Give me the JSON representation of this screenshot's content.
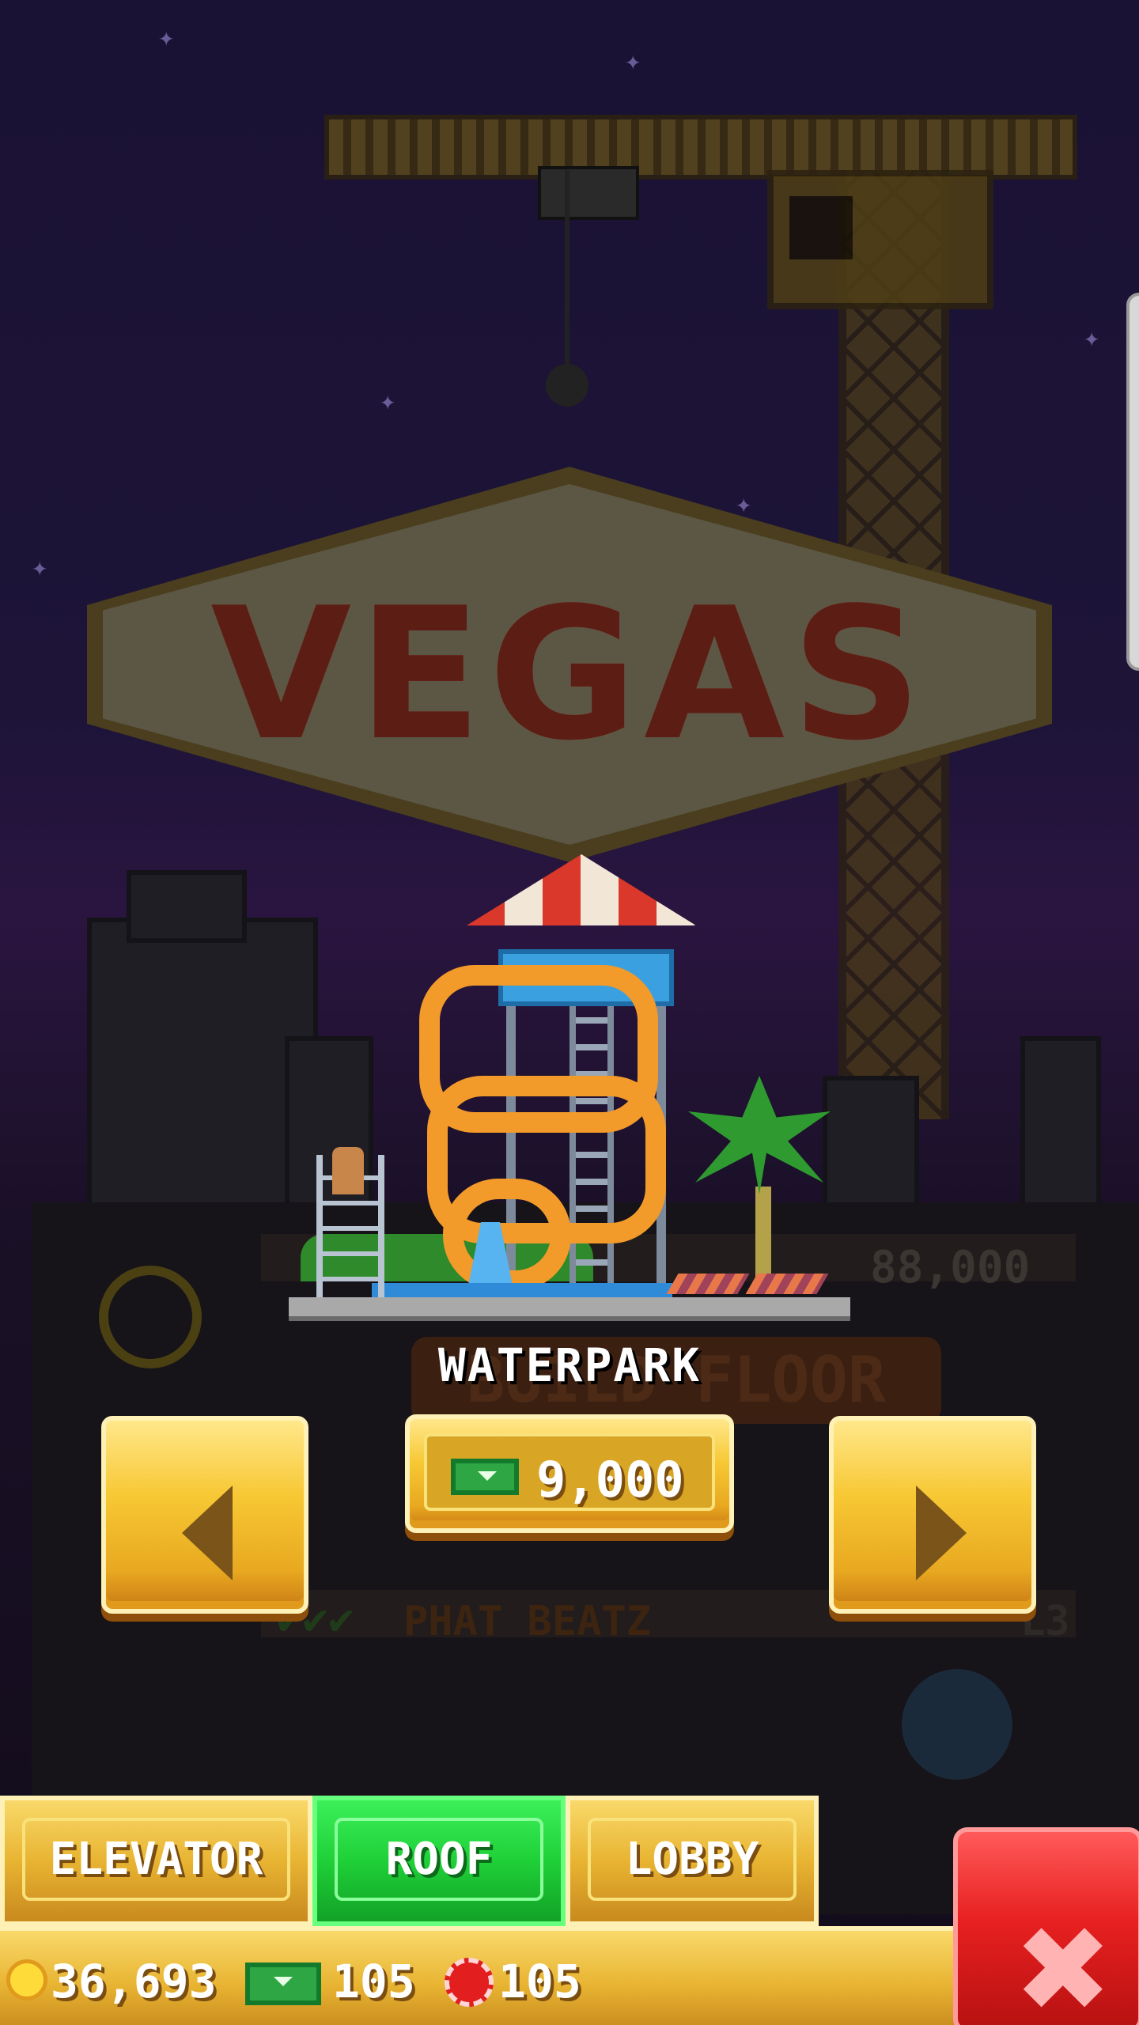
{
  "background": {
    "sign_text": "VEGAS",
    "dim_price": "88,000",
    "dim_build_floor": "BUILD FLOOR",
    "dim_floor_name": "PHAT BEATZ",
    "dim_floor_level": "L3",
    "dim_checks": "✔✔✔"
  },
  "preview": {
    "title": "WATERPARK",
    "price": "9,000",
    "price_currency_icon": "tower-bux-icon"
  },
  "nav": {
    "prev_icon": "triangle-left-icon",
    "next_icon": "triangle-right-icon"
  },
  "tabs": [
    {
      "label": "ELEVATOR",
      "active": false
    },
    {
      "label": "ROOF",
      "active": true
    },
    {
      "label": "LOBBY",
      "active": false
    }
  ],
  "status": {
    "coins": "36,693",
    "bux": "105",
    "chips": "105"
  },
  "close_icon": "close-x-icon",
  "colors": {
    "gold": "#f7c834",
    "active_green": "#1fd038",
    "close_red": "#e82020"
  }
}
